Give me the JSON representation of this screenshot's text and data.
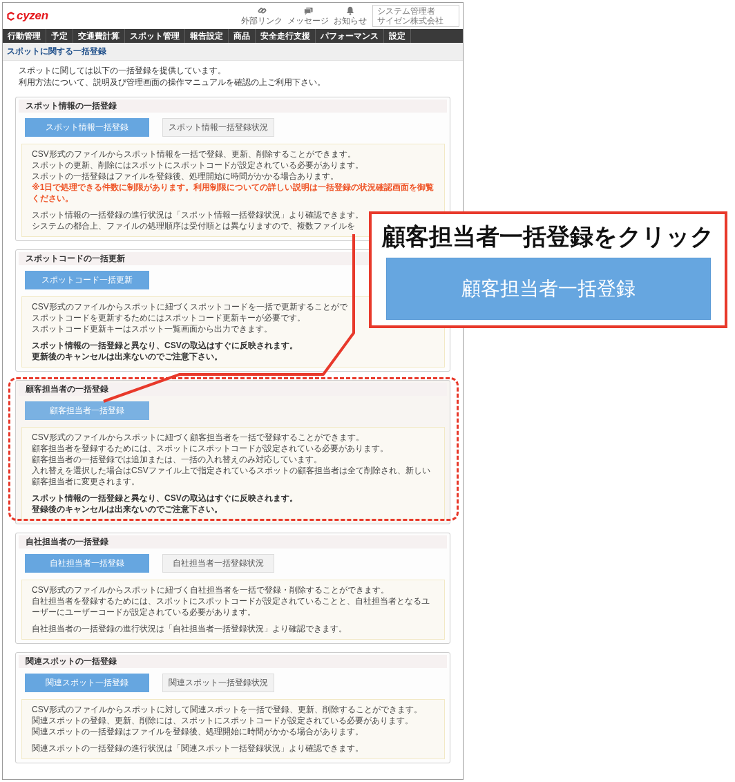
{
  "header": {
    "logo": "cyzen",
    "actions": [
      {
        "kind": "link",
        "label": "外部リンク"
      },
      {
        "kind": "message",
        "label": "メッセージ"
      },
      {
        "kind": "notice",
        "label": "お知らせ"
      }
    ],
    "user": {
      "name": "システム管理者",
      "company": "サイゼン株式会社"
    }
  },
  "nav": [
    {
      "label": "行動管理"
    },
    {
      "label": "予定"
    },
    {
      "label": "交通費計算"
    },
    {
      "label": "スポット管理"
    },
    {
      "label": "報告設定"
    },
    {
      "label": "商品"
    },
    {
      "label": "安全走行支援"
    },
    {
      "label": "パフォーマンス"
    },
    {
      "label": "設定"
    }
  ],
  "page_title": "スポットに関する一括登録",
  "intro": [
    "スポットに関しては以下の一括登録を提供しています。",
    "利用方法について、説明及び管理画面の操作マニュアルを確認の上ご利用下さい。"
  ],
  "sections": [
    {
      "title": "スポット情報の一括登録",
      "highlighted": false,
      "buttons": [
        {
          "kind": "primary",
          "label": "スポット情報一括登録"
        },
        {
          "kind": "secondary",
          "label": "スポット情報一括登録状況"
        }
      ],
      "paragraphs": [
        [
          {
            "kind": "normal",
            "text": "CSV形式のファイルからスポット情報を一括で登録、更新、削除することができます。"
          },
          {
            "kind": "normal",
            "text": "スポットの更新、削除にはスポットにスポットコードが設定されている必要があります。"
          },
          {
            "kind": "normal",
            "text": "スポットの一括登録はファイルを登録後、処理開始に時間がかかる場合あります。"
          },
          {
            "kind": "warning",
            "text": "※1日で処理できる件数に制限があります。利用制限についての詳しい説明は一括登録の状況確認画面を御覧ください。"
          }
        ],
        [
          {
            "kind": "normal",
            "text": "スポット情報の一括登録の進行状況は「スポット情報一括登録状況」より確認できます。"
          },
          {
            "kind": "normal",
            "text": "システムの都合上、ファイルの処理順序は受付順とは異なりますので、複数ファイルを"
          }
        ]
      ]
    },
    {
      "title": "スポットコードの一括更新",
      "highlighted": false,
      "buttons": [
        {
          "kind": "primary",
          "label": "スポットコード一括更新"
        }
      ],
      "paragraphs": [
        [
          {
            "kind": "normal",
            "text": "CSV形式のファイルからスポットに紐づくスポットコードを一括で更新することがで"
          },
          {
            "kind": "normal",
            "text": "スポットコードを更新するためにはスポットコード更新キーが必要です。"
          },
          {
            "kind": "normal",
            "text": "スポットコード更新キーはスポット一覧画面から出力できます。"
          }
        ],
        [
          {
            "kind": "bold",
            "text": "スポット情報の一括登録と異なり、CSVの取込はすぐに反映されます。"
          },
          {
            "kind": "bold",
            "text": "更新後のキャンセルは出来ないのでご注意下さい。"
          }
        ]
      ]
    },
    {
      "title": "顧客担当者の一括登録",
      "highlighted": true,
      "buttons": [
        {
          "kind": "primary",
          "label": "顧客担当者一括登録"
        }
      ],
      "paragraphs": [
        [
          {
            "kind": "normal",
            "text": "CSV形式のファイルからスポットに紐づく顧客担当者を一括で登録することができます。"
          },
          {
            "kind": "normal",
            "text": "顧客担当者を登録するためには、スポットにスポットコードが設定されている必要があります。"
          },
          {
            "kind": "normal",
            "text": "顧客担当者の一括登録では追加または、一括の入れ替えのみ対応しています。"
          },
          {
            "kind": "normal",
            "text": "入れ替えを選択した場合はCSVファイル上で指定されているスポットの顧客担当者は全て削除され、新しい顧客担当者に変更されます。"
          }
        ],
        [
          {
            "kind": "bold",
            "text": "スポット情報の一括登録と異なり、CSVの取込はすぐに反映されます。"
          },
          {
            "kind": "bold",
            "text": "登録後のキャンセルは出来ないのでご注意下さい。"
          }
        ]
      ]
    },
    {
      "title": "自社担当者の一括登録",
      "highlighted": false,
      "buttons": [
        {
          "kind": "primary",
          "label": "自社担当者一括登録"
        },
        {
          "kind": "secondary",
          "label": "自社担当者一括登録状況"
        }
      ],
      "paragraphs": [
        [
          {
            "kind": "normal",
            "text": "CSV形式のファイルからスポットに紐づく自社担当者を一括で登録・削除することができます。"
          },
          {
            "kind": "normal",
            "text": "自社担当者を登録するためには、スポットにスポットコードが設定されていることと、自社担当者となるユーザーにユーザーコードが設定されている必要があります。"
          }
        ],
        [
          {
            "kind": "normal",
            "text": "自社担当者の一括登録の進行状況は「自社担当者一括登録状況」より確認できます。"
          }
        ]
      ]
    },
    {
      "title": "関連スポットの一括登録",
      "highlighted": false,
      "buttons": [
        {
          "kind": "primary",
          "label": "関連スポット一括登録"
        },
        {
          "kind": "secondary",
          "label": "関連スポット一括登録状況"
        }
      ],
      "paragraphs": [
        [
          {
            "kind": "normal",
            "text": "CSV形式のファイルからスポットに対して関連スポットを一括で登録、更新、削除することができます。"
          },
          {
            "kind": "normal",
            "text": "関連スポットの登録、更新、削除には、スポットにスポットコードが設定されている必要があります。"
          },
          {
            "kind": "normal",
            "text": "関連スポットの一括登録はファイルを登録後、処理開始に時間がかかる場合があります。"
          }
        ],
        [
          {
            "kind": "normal",
            "text": "関連スポットの一括登録の進行状況は「関連スポット一括登録状況」より確認できます。"
          }
        ]
      ]
    }
  ],
  "callout": {
    "title": "顧客担当者一括登録をクリック",
    "button_label": "顧客担当者一括登録"
  }
}
